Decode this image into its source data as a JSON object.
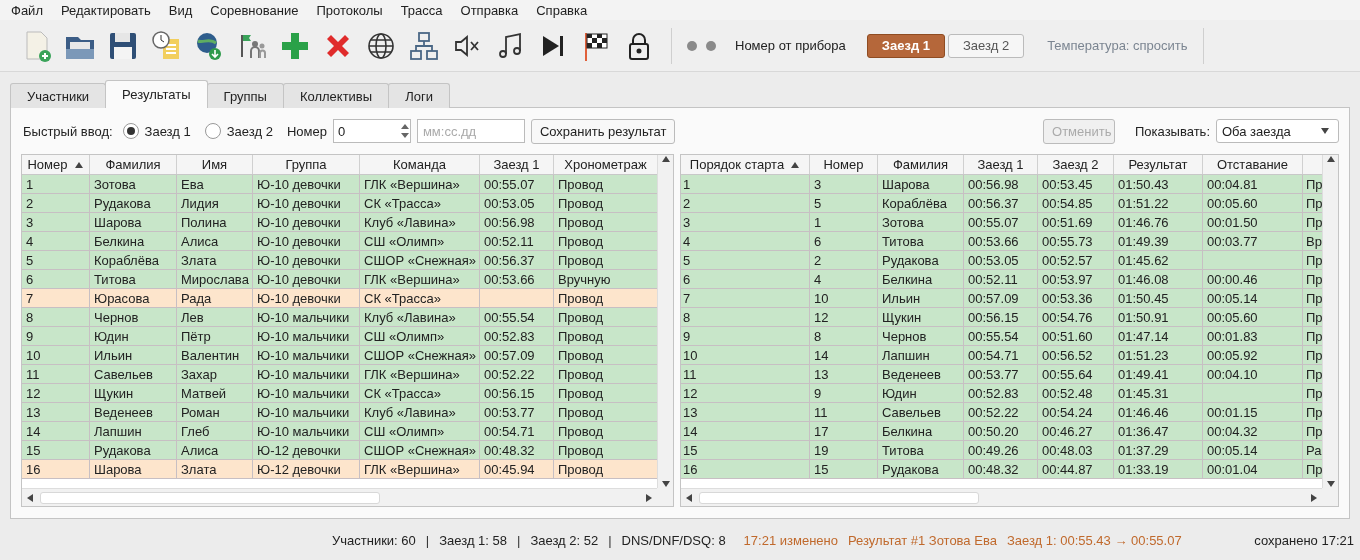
{
  "menu": [
    "Файл",
    "Редактировать",
    "Вид",
    "Соревнование",
    "Протоколы",
    "Трасса",
    "Отправка",
    "Справка"
  ],
  "toolbar": {
    "device_label": "Номер от прибора",
    "heats": [
      {
        "label": "Заезд 1",
        "selected": true
      },
      {
        "label": "Заезд 2",
        "selected": false
      }
    ],
    "temperature": "Температура: спросить"
  },
  "tabs": [
    {
      "label": "Участники",
      "selected": false
    },
    {
      "label": "Результаты",
      "selected": true
    },
    {
      "label": "Группы",
      "selected": false
    },
    {
      "label": "Коллективы",
      "selected": false
    },
    {
      "label": "Логи",
      "selected": false
    }
  ],
  "quick_entry": {
    "label": "Быстрый ввод:",
    "heats": [
      {
        "label": "Заезд 1",
        "selected": true
      },
      {
        "label": "Заезд 2",
        "selected": false
      }
    ],
    "number_label": "Номер",
    "number_value": "0",
    "time_placeholder": "мм:сс.дд",
    "save_button": "Сохранить результат",
    "cancel_button": {
      "label": "Отменить",
      "disabled": true
    },
    "show_label": "Показывать:",
    "show_value": "Оба заезда"
  },
  "left_table": {
    "columns": [
      {
        "label": "Номер",
        "sorted": true
      },
      {
        "label": "Фамилия",
        "sorted": false
      },
      {
        "label": "Имя",
        "sorted": false
      },
      {
        "label": "Группа",
        "sorted": false
      },
      {
        "label": "Команда",
        "sorted": false
      },
      {
        "label": "Заезд 1",
        "sorted": false
      },
      {
        "label": "Хронометраж",
        "sorted": false
      }
    ],
    "rows": [
      {
        "color": "#c8e6c9",
        "cells": [
          "1",
          "Зотова",
          "Ева",
          "Ю-10 девочки",
          "ГЛК «Вершина»",
          "00:55.07",
          "Провод"
        ]
      },
      {
        "color": "#c8e6c9",
        "cells": [
          "2",
          "Рудакова",
          "Лидия",
          "Ю-10 девочки",
          "СК «Трасса»",
          "00:53.05",
          "Провод"
        ]
      },
      {
        "color": "#c8e6c9",
        "cells": [
          "3",
          "Шарова",
          "Полина",
          "Ю-10 девочки",
          "Клуб «Лавина»",
          "00:56.98",
          "Провод"
        ]
      },
      {
        "color": "#c8e6c9",
        "cells": [
          "4",
          "Белкина",
          "Алиса",
          "Ю-10 девочки",
          "СШ «Олимп»",
          "00:52.11",
          "Провод"
        ]
      },
      {
        "color": "#c8e6c9",
        "cells": [
          "5",
          "Кораблёва",
          "Злата",
          "Ю-10 девочки",
          "СШОР «Снежная»",
          "00:56.37",
          "Провод"
        ]
      },
      {
        "color": "#c8e6c9",
        "cells": [
          "6",
          "Титова",
          "Мирослава",
          "Ю-10 девочки",
          "ГЛК «Вершина»",
          "00:53.66",
          "Вручную"
        ]
      },
      {
        "color": "#fde5cc",
        "cells": [
          "7",
          "Юрасова",
          "Рада",
          "Ю-10 девочки",
          "СК «Трасса»",
          "",
          "Провод"
        ]
      },
      {
        "color": "#c8e6c9",
        "cells": [
          "8",
          "Чернов",
          "Лев",
          "Ю-10 мальчики",
          "Клуб «Лавина»",
          "00:55.54",
          "Провод"
        ]
      },
      {
        "color": "#c8e6c9",
        "cells": [
          "9",
          "Юдин",
          "Пётр",
          "Ю-10 мальчики",
          "СШ «Олимп»",
          "00:52.83",
          "Провод"
        ]
      },
      {
        "color": "#c8e6c9",
        "cells": [
          "10",
          "Ильин",
          "Валентин",
          "Ю-10 мальчики",
          "СШОР «Снежная»",
          "00:57.09",
          "Провод"
        ]
      },
      {
        "color": "#c8e6c9",
        "cells": [
          "11",
          "Савельев",
          "Захар",
          "Ю-10 мальчики",
          "ГЛК «Вершина»",
          "00:52.22",
          "Провод"
        ]
      },
      {
        "color": "#c8e6c9",
        "cells": [
          "12",
          "Щукин",
          "Матвей",
          "Ю-10 мальчики",
          "СК «Трасса»",
          "00:56.15",
          "Провод"
        ]
      },
      {
        "color": "#c8e6c9",
        "cells": [
          "13",
          "Веденеев",
          "Роман",
          "Ю-10 мальчики",
          "Клуб «Лавина»",
          "00:53.77",
          "Провод"
        ]
      },
      {
        "color": "#c8e6c9",
        "cells": [
          "14",
          "Лапшин",
          "Глеб",
          "Ю-10 мальчики",
          "СШ «Олимп»",
          "00:54.71",
          "Провод"
        ]
      },
      {
        "color": "#c8e6c9",
        "cells": [
          "15",
          "Рудакова",
          "Алиса",
          "Ю-12 девочки",
          "СШОР «Снежная»",
          "00:48.32",
          "Провод"
        ]
      },
      {
        "color": "#fde5cc",
        "cells": [
          "16",
          "Шарова",
          "Злата",
          "Ю-12 девочки",
          "ГЛК «Вершина»",
          "00:45.94",
          "Провод"
        ]
      }
    ]
  },
  "right_table": {
    "columns": [
      {
        "label": "Порядок старта",
        "sorted": true
      },
      {
        "label": "Номер",
        "sorted": false
      },
      {
        "label": "Фамилия",
        "sorted": false
      },
      {
        "label": "Заезд 1",
        "sorted": false
      },
      {
        "label": "Заезд 2",
        "sorted": false
      },
      {
        "label": "Результат",
        "sorted": false
      },
      {
        "label": "Отставание",
        "sorted": false
      }
    ],
    "rows": [
      {
        "color": "#c8e6c9",
        "cells": [
          "1",
          "3",
          "Шарова",
          "00:56.98",
          "00:53.45",
          "01:50.43",
          "00:04.81",
          "Пр"
        ]
      },
      {
        "color": "#c8e6c9",
        "cells": [
          "2",
          "5",
          "Кораблёва",
          "00:56.37",
          "00:54.85",
          "01:51.22",
          "00:05.60",
          "Пр"
        ]
      },
      {
        "color": "#c8e6c9",
        "cells": [
          "3",
          "1",
          "Зотова",
          "00:55.07",
          "00:51.69",
          "01:46.76",
          "00:01.50",
          "Пр"
        ]
      },
      {
        "color": "#c8e6c9",
        "cells": [
          "4",
          "6",
          "Титова",
          "00:53.66",
          "00:55.73",
          "01:49.39",
          "00:03.77",
          "Вр"
        ]
      },
      {
        "color": "#c8e6c9",
        "cells": [
          "5",
          "2",
          "Рудакова",
          "00:53.05",
          "00:52.57",
          "01:45.62",
          "",
          "Пр"
        ]
      },
      {
        "color": "#c8e6c9",
        "cells": [
          "6",
          "4",
          "Белкина",
          "00:52.11",
          "00:53.97",
          "01:46.08",
          "00:00.46",
          "Пр"
        ]
      },
      {
        "color": "#c8e6c9",
        "cells": [
          "7",
          "10",
          "Ильин",
          "00:57.09",
          "00:53.36",
          "01:50.45",
          "00:05.14",
          "Пр"
        ]
      },
      {
        "color": "#c8e6c9",
        "cells": [
          "8",
          "12",
          "Щукин",
          "00:56.15",
          "00:54.76",
          "01:50.91",
          "00:05.60",
          "Пр"
        ]
      },
      {
        "color": "#c8e6c9",
        "cells": [
          "9",
          "8",
          "Чернов",
          "00:55.54",
          "00:51.60",
          "01:47.14",
          "00:01.83",
          "Пр"
        ]
      },
      {
        "color": "#c8e6c9",
        "cells": [
          "10",
          "14",
          "Лапшин",
          "00:54.71",
          "00:56.52",
          "01:51.23",
          "00:05.92",
          "Пр"
        ]
      },
      {
        "color": "#c8e6c9",
        "cells": [
          "11",
          "13",
          "Веденеев",
          "00:53.77",
          "00:55.64",
          "01:49.41",
          "00:04.10",
          "Пр"
        ]
      },
      {
        "color": "#c8e6c9",
        "cells": [
          "12",
          "9",
          "Юдин",
          "00:52.83",
          "00:52.48",
          "01:45.31",
          "",
          "Пр"
        ]
      },
      {
        "color": "#c8e6c9",
        "cells": [
          "13",
          "11",
          "Савельев",
          "00:52.22",
          "00:54.24",
          "01:46.46",
          "00:01.15",
          "Пр"
        ]
      },
      {
        "color": "#c8e6c9",
        "cells": [
          "14",
          "17",
          "Белкина",
          "00:50.20",
          "00:46.27",
          "01:36.47",
          "00:04.32",
          "Пр"
        ]
      },
      {
        "color": "#c8e6c9",
        "cells": [
          "15",
          "19",
          "Титова",
          "00:49.26",
          "00:48.03",
          "01:37.29",
          "00:05.14",
          "Ра"
        ]
      },
      {
        "color": "#c8e6c9",
        "cells": [
          "16",
          "15",
          "Рудакова",
          "00:48.32",
          "00:44.87",
          "01:33.19",
          "00:01.04",
          "Пр"
        ]
      }
    ]
  },
  "status_bar": {
    "items": [
      {
        "kind": "count",
        "text": "Участники: 60"
      },
      {
        "kind": "separator",
        "text": "|"
      },
      {
        "kind": "count",
        "text": "Заезд 1: 58"
      },
      {
        "kind": "separator",
        "text": "|"
      },
      {
        "kind": "count",
        "text": "Заезд 2: 52"
      },
      {
        "kind": "separator",
        "text": "|"
      },
      {
        "kind": "count",
        "text": "DNS/DNF/DSQ: 8"
      },
      {
        "kind": "change",
        "text": "17:21 изменено"
      },
      {
        "kind": "change",
        "text": "Результат #1 Зотова Ева"
      },
      {
        "kind": "change",
        "text": "Заезд 1: 00:55.43 → 00:55.07"
      }
    ],
    "saved": "сохранено 17:21"
  }
}
